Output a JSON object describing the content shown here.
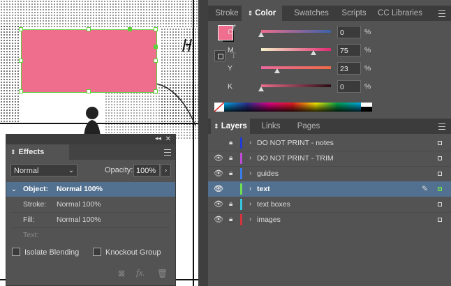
{
  "colors": {
    "fill": "#ef6d8d",
    "selection": "#5fd13a",
    "active_row": "#52708f"
  },
  "effects_panel": {
    "tab_label": "Effects",
    "blend_mode": "Normal",
    "opacity_label": "Opacity:",
    "opacity_value": "100%",
    "rows": [
      {
        "key": "Object:",
        "value": "Normal 100%"
      },
      {
        "key": "Stroke:",
        "value": "Normal 100%"
      },
      {
        "key": "Fill:",
        "value": "Normal 100%"
      },
      {
        "key": "Text:",
        "value": ""
      }
    ],
    "isolate_label": "Isolate Blending",
    "knockout_label": "Knockout Group",
    "fx_label": "fx."
  },
  "color_panel": {
    "tabs": [
      "Stroke",
      "Color",
      "Swatches",
      "Scripts",
      "CC Libraries"
    ],
    "selected_tab": "Color",
    "format_text_icon": "T",
    "channels": [
      {
        "label": "C",
        "value": "0",
        "unit": "%",
        "level": 0
      },
      {
        "label": "M",
        "value": "75",
        "unit": "%",
        "level": 75
      },
      {
        "label": "Y",
        "value": "23",
        "unit": "%",
        "level": 23
      },
      {
        "label": "K",
        "value": "0",
        "unit": "%",
        "level": 0
      }
    ]
  },
  "layers_panel": {
    "tabs": [
      "Layers",
      "Links",
      "Pages"
    ],
    "selected_tab": "Layers",
    "layers": [
      {
        "name": "DO NOT PRINT - notes",
        "color": "#1f3bd6",
        "visible": false,
        "locked": true
      },
      {
        "name": "DO NOT PRINT - TRIM",
        "color": "#c04bd8",
        "visible": true,
        "locked": true
      },
      {
        "name": "guides",
        "color": "#3a7ee8",
        "visible": true,
        "locked": true
      },
      {
        "name": "text",
        "color": "#6fe04f",
        "visible": true,
        "locked": false,
        "selected": true
      },
      {
        "name": "text boxes",
        "color": "#37c7df",
        "visible": true,
        "locked": true
      },
      {
        "name": "images",
        "color": "#d8323c",
        "visible": true,
        "locked": true
      }
    ]
  }
}
